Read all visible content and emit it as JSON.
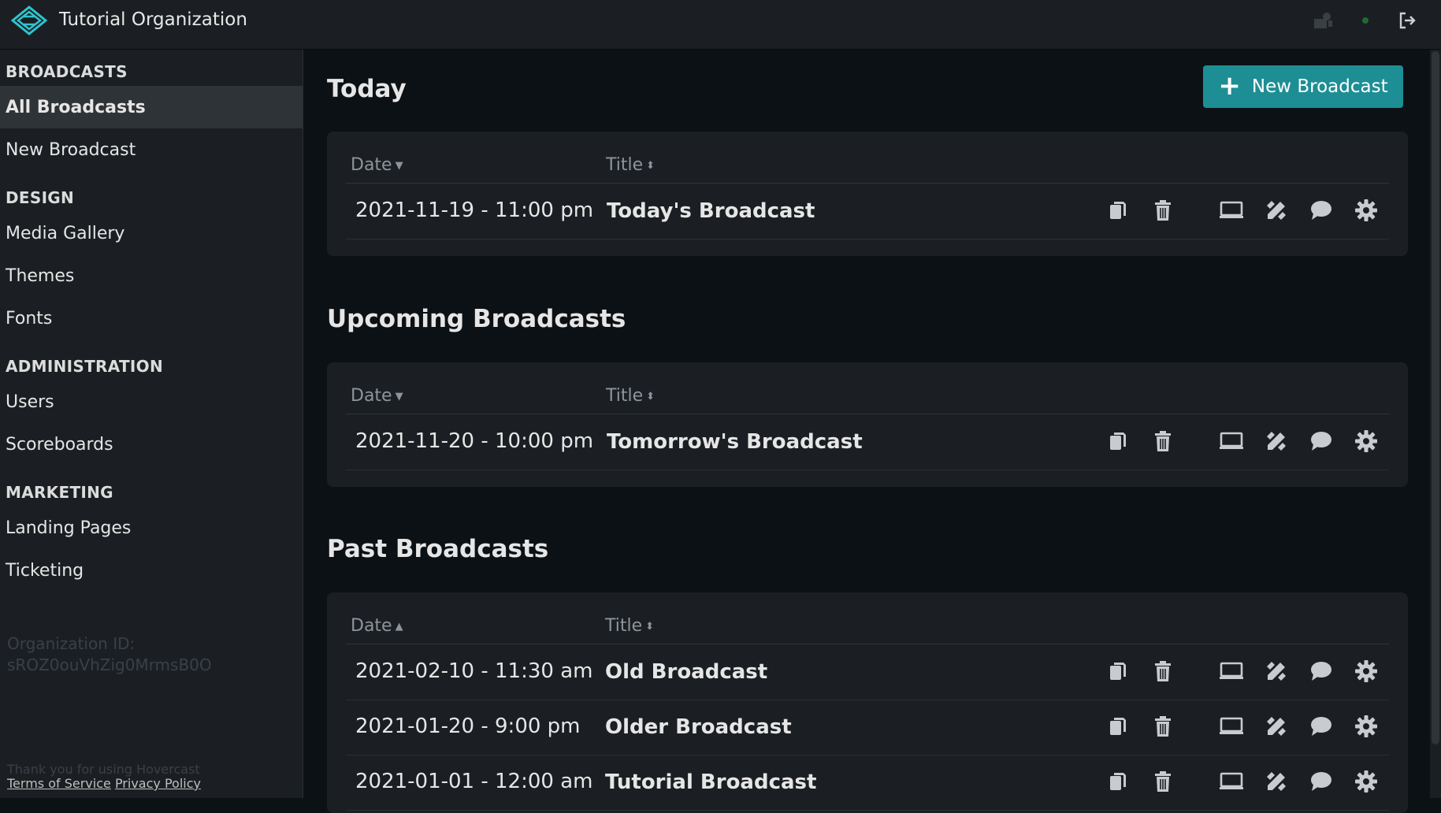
{
  "app": {
    "org_name": "Tutorial Organization",
    "logo_icon": "hovercast-logo-icon",
    "accent_color": "#1e8e95"
  },
  "topbar": {
    "icons": [
      "presenter-icon",
      "status-dot-icon",
      "logout-icon"
    ]
  },
  "sidebar": {
    "sections": [
      {
        "label": "BROADCASTS",
        "items": [
          "All Broadcasts",
          "New Broadcast"
        ]
      },
      {
        "label": "DESIGN",
        "items": [
          "Media Gallery",
          "Themes",
          "Fonts"
        ]
      },
      {
        "label": "ADMINISTRATION",
        "items": [
          "Users",
          "Scoreboards"
        ]
      },
      {
        "label": "MARKETING",
        "items": [
          "Landing Pages",
          "Ticketing"
        ]
      }
    ],
    "active_item": "All Broadcasts",
    "org_id_label": "Organization ID:",
    "org_id_value": "sROZ0ouVhZig0MrmsB0O",
    "thanks": "Thank you for using Hovercast",
    "terms": "Terms of Service",
    "privacy": "Privacy Policy"
  },
  "main": {
    "new_broadcast_button": "New Broadcast",
    "table_headers": {
      "date": "Date",
      "title": "Title"
    },
    "groups": [
      {
        "heading": "Today",
        "date_sort": "desc",
        "rows": [
          {
            "date": "2021-11-19 - 11:00 pm",
            "title": "Today's Broadcast"
          }
        ]
      },
      {
        "heading": "Upcoming Broadcasts",
        "date_sort": "desc",
        "rows": [
          {
            "date": "2021-11-20 - 10:00 pm",
            "title": "Tomorrow's Broadcast"
          }
        ]
      },
      {
        "heading": "Past Broadcasts",
        "date_sort": "asc",
        "rows": [
          {
            "date": "2021-02-10 - 11:30 am",
            "title": "Old Broadcast"
          },
          {
            "date": "2021-01-20 - 9:00 pm",
            "title": "Older Broadcast"
          },
          {
            "date": "2021-01-01 - 12:00 am",
            "title": "Tutorial Broadcast"
          }
        ]
      }
    ],
    "row_action_icons": [
      "copy-icon",
      "trash-icon",
      "monitor-icon",
      "design-icon",
      "chat-icon",
      "gear-icon"
    ]
  }
}
